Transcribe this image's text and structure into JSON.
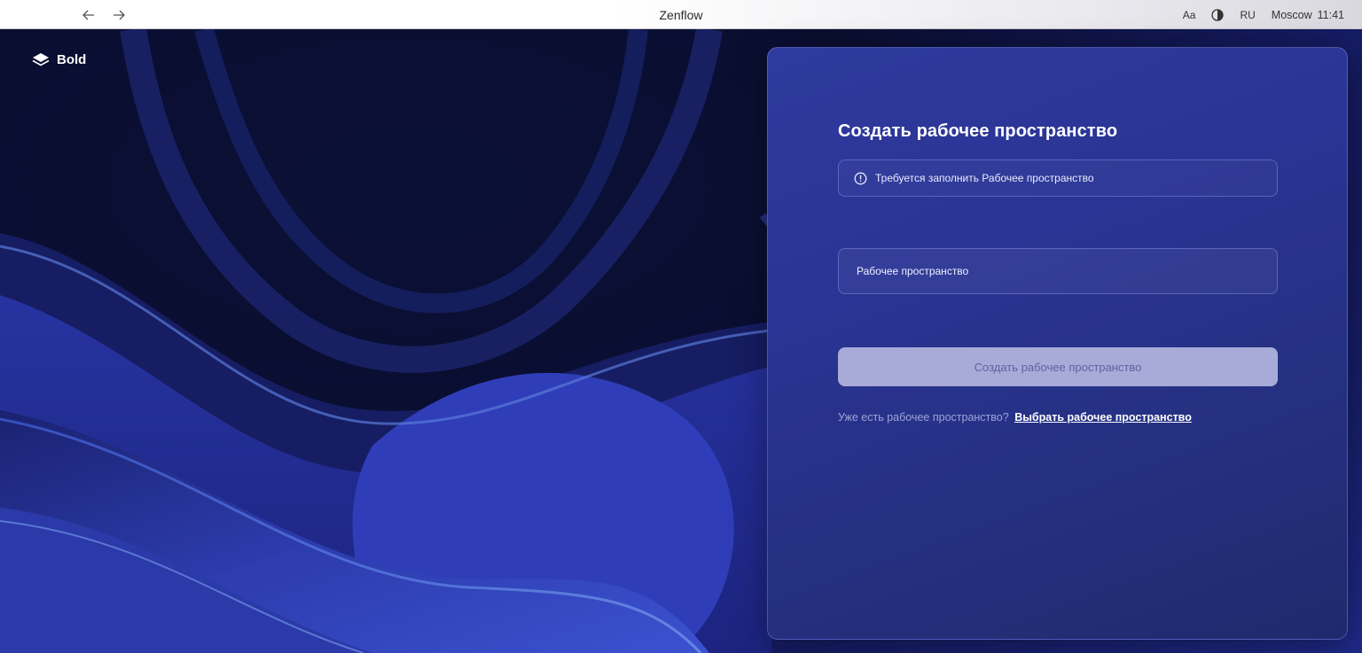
{
  "window": {
    "title": "Zenflow",
    "font_size_label": "Aa",
    "language": "RU",
    "city": "Moscow",
    "time": "11:41"
  },
  "icons": {
    "back": "arrow-left-icon",
    "forward": "arrow-right-icon",
    "theme": "contrast-icon",
    "brand": "layers-logo-icon",
    "alert": "info-circle-icon"
  },
  "brand": {
    "name": "Bold"
  },
  "form": {
    "heading": "Создать рабочее пространство",
    "alert_text": "Требуется заполнить Рабочее пространство",
    "workspace_value": "",
    "workspace_placeholder": "Рабочее пространство",
    "submit_label": "Создать рабочее пространство",
    "footer_text": "Уже есть рабочее пространство?",
    "footer_link": "Выбрать рабочее пространство"
  },
  "colors": {
    "card": "#2a3494",
    "button_disabled": "#a8abd8",
    "link": "#ffffff"
  }
}
